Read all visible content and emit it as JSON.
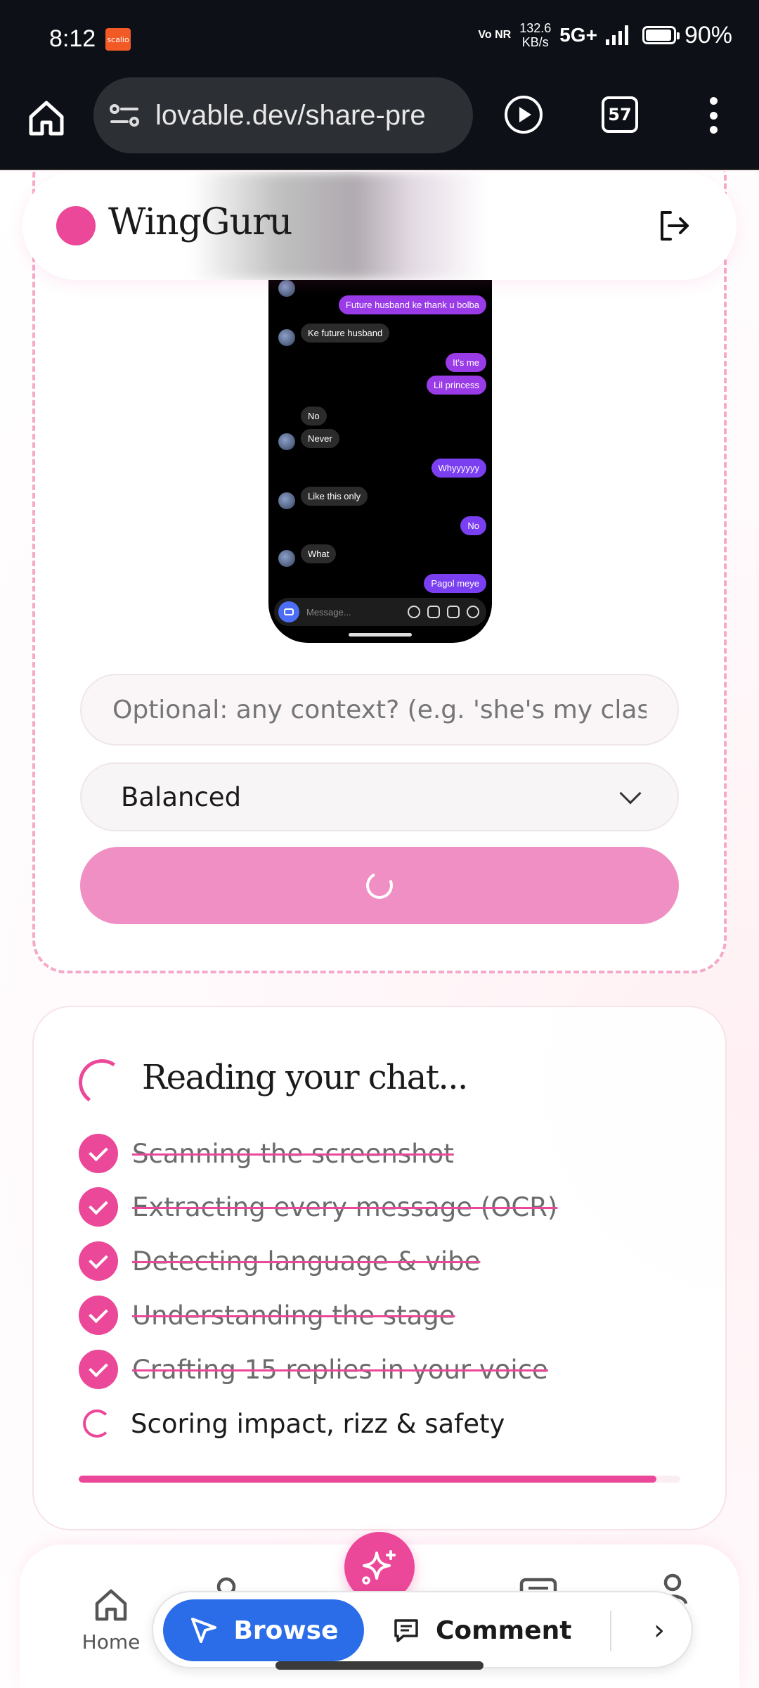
{
  "status_bar": {
    "time": "8:12",
    "notification_app": "scalio",
    "volte": "Vo NR",
    "net_speed_value": "132.6",
    "net_speed_unit": "KB/s",
    "network": "5G+",
    "battery": "90%"
  },
  "browser": {
    "url": "lovable.dev/share-pre",
    "tab_count": "57"
  },
  "app": {
    "brand": "WingGuru"
  },
  "chat_preview": {
    "messages": [
      {
        "from": "me",
        "text": "Future husband ke thank u bolba"
      },
      {
        "from": "them",
        "text": "Ke future husband"
      },
      {
        "from": "me",
        "text": "It's me"
      },
      {
        "from": "me",
        "text": "Lil princess"
      },
      {
        "from": "them",
        "text": "No"
      },
      {
        "from": "them",
        "text": "Never"
      },
      {
        "from": "me",
        "text": "Whyyyyyy"
      },
      {
        "from": "them",
        "text": "Like this only"
      },
      {
        "from": "me",
        "text": "No"
      },
      {
        "from": "them",
        "text": "What"
      },
      {
        "from": "me",
        "text": "Pagol meye"
      }
    ],
    "composer_placeholder": "Message..."
  },
  "form": {
    "context_placeholder": "Optional: any context? (e.g. 'she's my clas",
    "tone_value": "Balanced"
  },
  "progress": {
    "title": "Reading your chat...",
    "steps": [
      {
        "label": "Scanning the screenshot",
        "done": true
      },
      {
        "label": "Extracting every message (OCR)",
        "done": true
      },
      {
        "label": "Detecting language & vibe",
        "done": true
      },
      {
        "label": "Understanding the stage",
        "done": true
      },
      {
        "label": "Crafting 15 replies in your voice",
        "done": true
      },
      {
        "label": "Scoring impact, rizz & safety",
        "done": false
      }
    ],
    "percent": 96
  },
  "bottom_nav": {
    "home_label": "Home"
  },
  "float_toolbar": {
    "browse_label": "Browse",
    "comment_label": "Comment",
    "next_glyph": "›"
  },
  "colors": {
    "brand": "#ec4899",
    "button_loading": "#f08fc4",
    "browse": "#2b6de8"
  }
}
